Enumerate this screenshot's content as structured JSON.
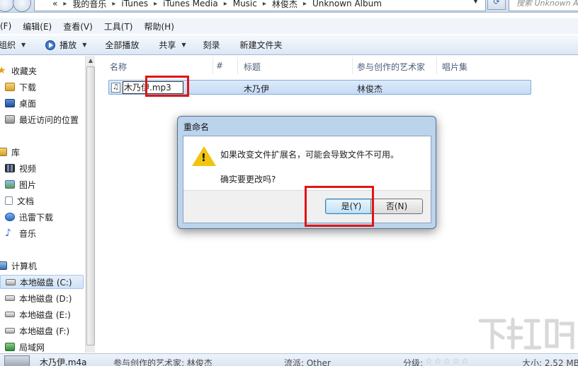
{
  "address_bar": {
    "breadcrumb": [
      "«",
      "我的音乐",
      "iTunes",
      "iTunes Media",
      "Music",
      "林俊杰",
      "Unknown Album"
    ],
    "search_placeholder": "搜索 Unknown A"
  },
  "menu": [
    "(F)",
    "编辑(E)",
    "查看(V)",
    "工具(T)",
    "帮助(H)"
  ],
  "toolbar": {
    "organize": "组织",
    "play": "播放",
    "play_all": "全部播放",
    "share": "共享",
    "burn": "刻录",
    "new_folder": "新建文件夹"
  },
  "nav": {
    "favorites": "收藏夹",
    "downloads": "下载",
    "desktop": "桌面",
    "recent": "最近访问的位置",
    "libraries": "库",
    "videos": "视频",
    "pictures": "图片",
    "documents": "文档",
    "xunlei": "迅雷下载",
    "music": "音乐",
    "computer": "计算机",
    "drive_c": "本地磁盘 (C:)",
    "drive_d": "本地磁盘 (D:)",
    "drive_e": "本地磁盘 (E:)",
    "drive_f": "本地磁盘 (F:)",
    "network": "局域网"
  },
  "columns": {
    "name": "名称",
    "number": "#",
    "title": "标题",
    "artist": "参与创作的艺术家",
    "album": "唱片集"
  },
  "file": {
    "rename_prefix": "木乃伊",
    "rename_ext": ".mp3",
    "title": "木乃伊",
    "artist": "林俊杰"
  },
  "dialog": {
    "title": "重命名",
    "message": "如果改变文件扩展名，可能会导致文件不可用。",
    "question": "确实要更改吗?",
    "yes": "是(Y)",
    "no": "否(N)"
  },
  "details": {
    "filename": "木乃伊.m4a",
    "artist_label": "参与创作的艺术家: 林俊杰",
    "genre_label": "流派: Other",
    "rating_label": "分级:",
    "size_label": "大小: 2.52 MB"
  },
  "watermark": "下载吧",
  "colors": {
    "highlight_red": "#e01515",
    "selection": "#c5dbf6",
    "warning": "#f1c40f"
  }
}
